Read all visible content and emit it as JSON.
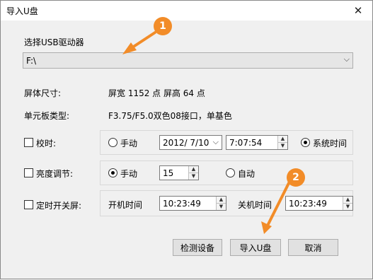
{
  "window": {
    "title": "导入U盘",
    "close": "✕"
  },
  "usb": {
    "label": "选择USB驱动器",
    "value": "F:\\"
  },
  "screen_size": {
    "label": "屏体尺寸:",
    "value": "屏宽 1152 点 屏高 64 点"
  },
  "board_type": {
    "label": "单元板类型:",
    "value": "F3.75/F5.0双色08接口，单基色"
  },
  "timing": {
    "label": "校时:",
    "manual": "手动",
    "date": "2012/  7/10",
    "time": "7:07:54",
    "system_time": "系统时间"
  },
  "brightness": {
    "label": "亮度调节:",
    "manual": "手动",
    "value": "15",
    "auto": "自动"
  },
  "schedule": {
    "label": "定时开关屏:",
    "on_label": "开机时间",
    "on_time": "10:23:49",
    "off_label": "关机时间",
    "off_time": "10:23:49"
  },
  "buttons": {
    "detect": "检测设备",
    "import": "导入U盘",
    "cancel": "取消"
  },
  "annotations": {
    "badge1": "1",
    "badge2": "2",
    "color": "#f28c28"
  }
}
